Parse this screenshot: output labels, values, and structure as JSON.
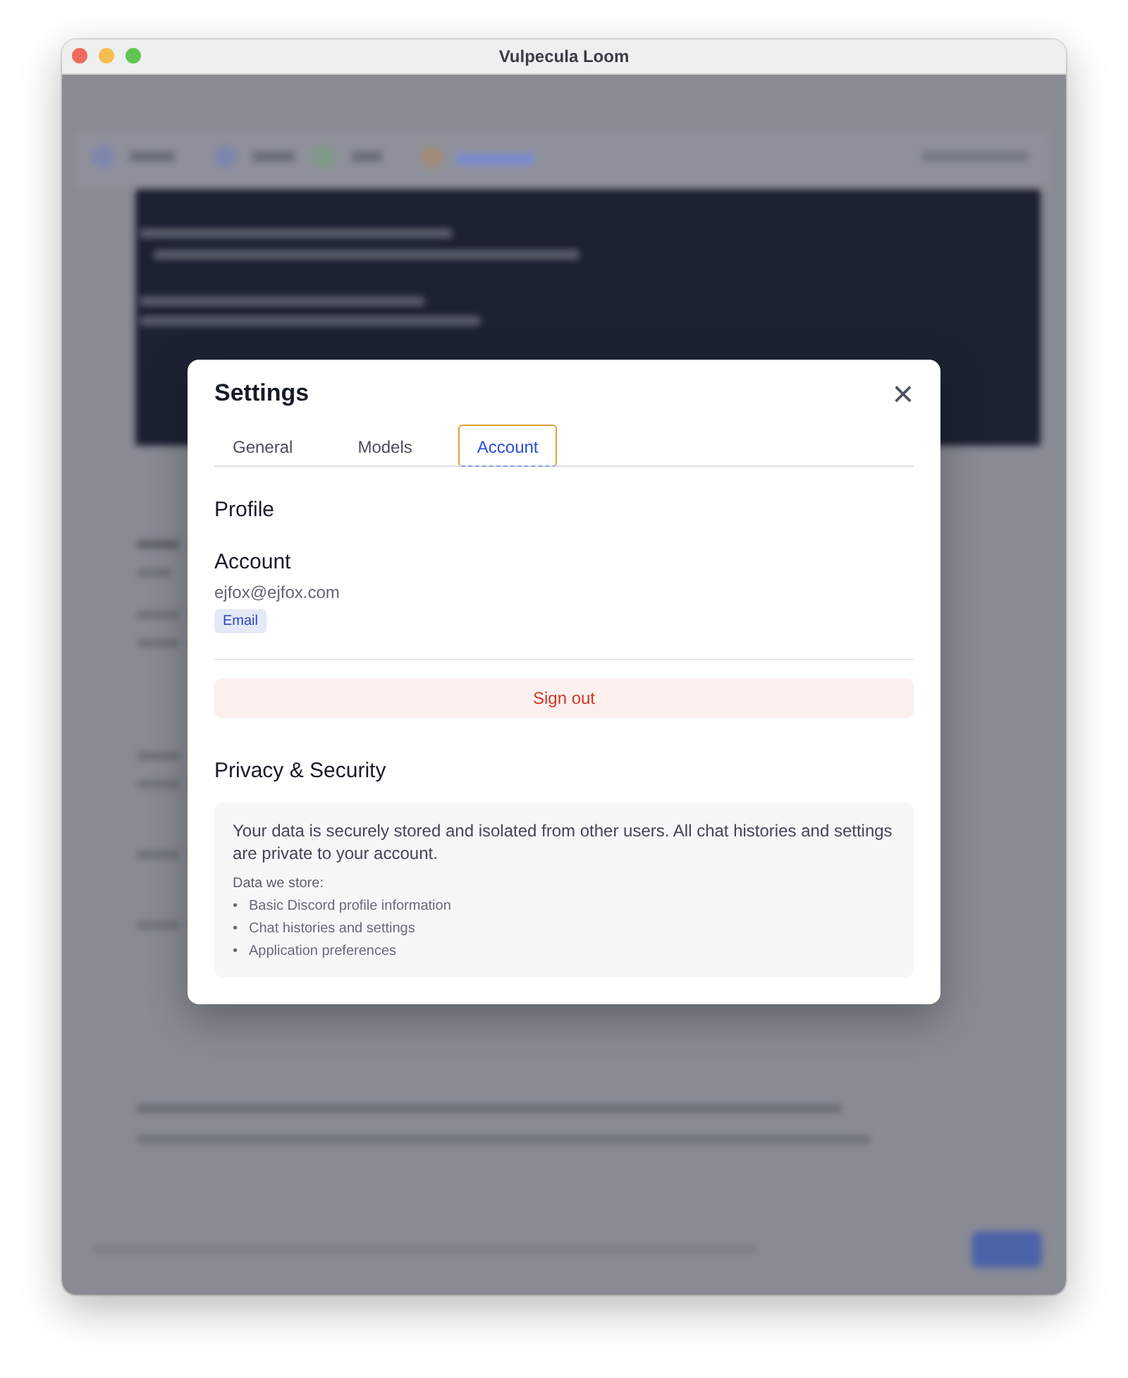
{
  "window": {
    "title": "Vulpecula Loom"
  },
  "settings": {
    "title": "Settings",
    "close": "×",
    "tabs": [
      {
        "label": "General",
        "selected": false
      },
      {
        "label": "Models",
        "selected": false
      },
      {
        "label": "Account",
        "selected": true
      }
    ],
    "profile": {
      "heading": "Profile",
      "subheading": "Account",
      "email": "ejfox@ejfox.com",
      "badge": "Email",
      "sign_out": "Sign out"
    },
    "privacy": {
      "heading": "Privacy & Security",
      "description": "Your data is securely stored and isolated from other users. All chat histories and settings are private to your account.",
      "list_title": "Data we store:",
      "items": [
        {
          "marker": "•",
          "text": "Basic Discord profile information"
        },
        {
          "marker": "•",
          "text": "Chat histories and settings"
        },
        {
          "marker": "•",
          "text": "Application preferences"
        }
      ]
    }
  }
}
